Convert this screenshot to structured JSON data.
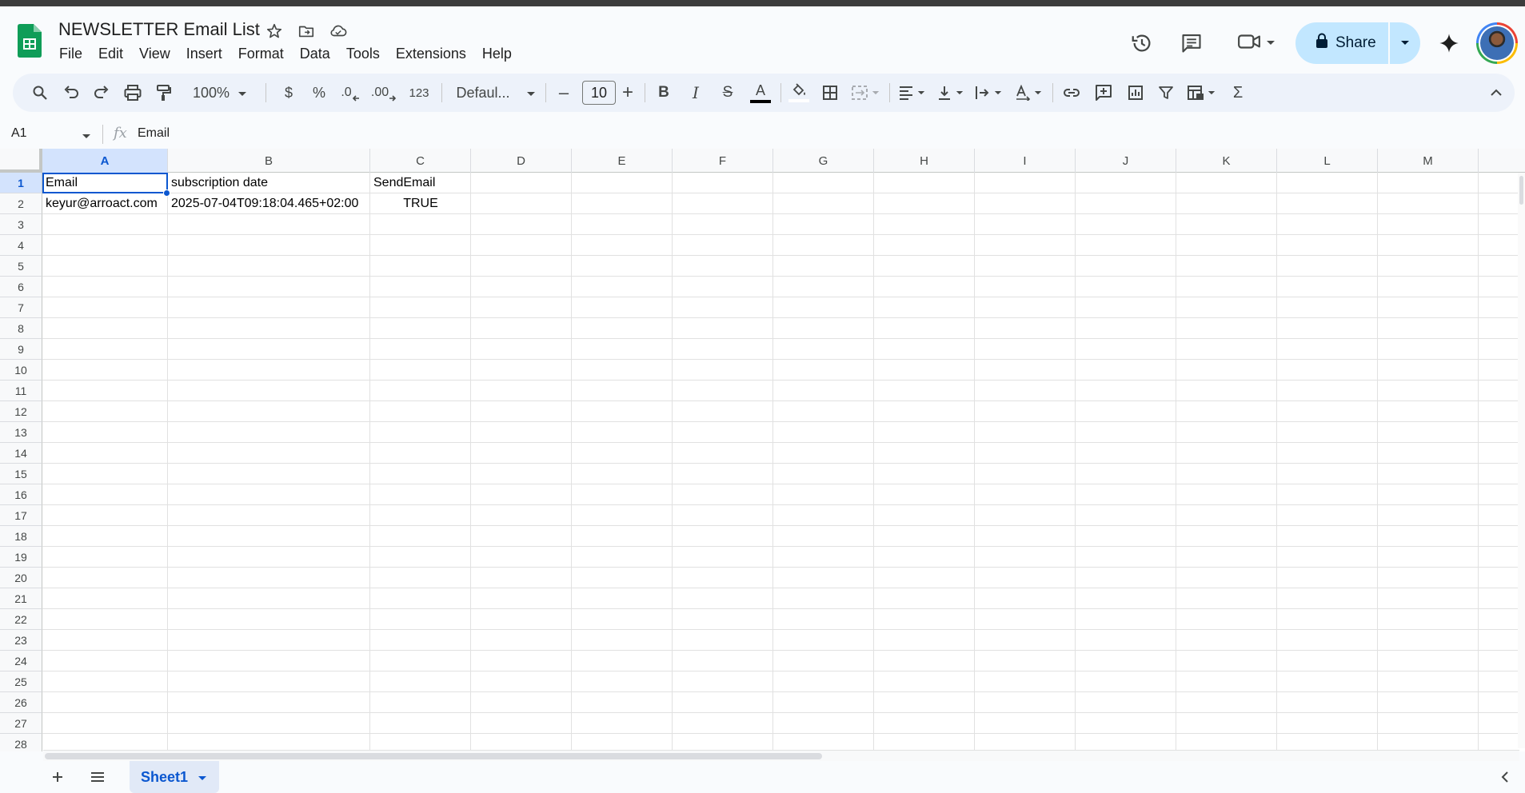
{
  "doc": {
    "title": "NEWSLETTER Email List"
  },
  "menu": [
    "File",
    "Edit",
    "View",
    "Insert",
    "Format",
    "Data",
    "Tools",
    "Extensions",
    "Help"
  ],
  "share": {
    "label": "Share"
  },
  "toolbar": {
    "zoom": "100%",
    "currency": "$",
    "percent": "%",
    "decrease_decimal": ".0",
    "increase_decimal": ".00",
    "number_format": "123",
    "font": "Defaul...",
    "font_size": "10",
    "font_size_minus": "–",
    "font_size_plus": "+",
    "bold": "B",
    "italic": "I",
    "strike": "S",
    "text_color": "A",
    "sum": "Σ"
  },
  "formula_bar": {
    "cell_ref": "A1",
    "fx": "fx",
    "value": "Email"
  },
  "columns": [
    "A",
    "B",
    "C",
    "D",
    "E",
    "F",
    "G",
    "H",
    "I",
    "J",
    "K",
    "L",
    "M"
  ],
  "rows": [
    "1",
    "2",
    "3",
    "4",
    "5",
    "6",
    "7",
    "8",
    "9",
    "10",
    "11",
    "12",
    "13",
    "14",
    "15",
    "16",
    "17",
    "18",
    "19",
    "20",
    "21",
    "22",
    "23",
    "24",
    "25",
    "26",
    "27",
    "28"
  ],
  "cells": {
    "A1": "Email",
    "B1": "subscription date",
    "C1": "SendEmail",
    "A2": "keyur@arroact.com",
    "B2": "2025-07-04T09:18:04.465+02:00",
    "C2": "TRUE"
  },
  "selected_cell": "A1",
  "sheet": {
    "tab": "Sheet1"
  },
  "colors": {
    "accent": "#0b57d0",
    "share_bg": "#c2e7ff",
    "selection_bg": "#d3e3fd",
    "logo_green": "#0f9d58"
  }
}
